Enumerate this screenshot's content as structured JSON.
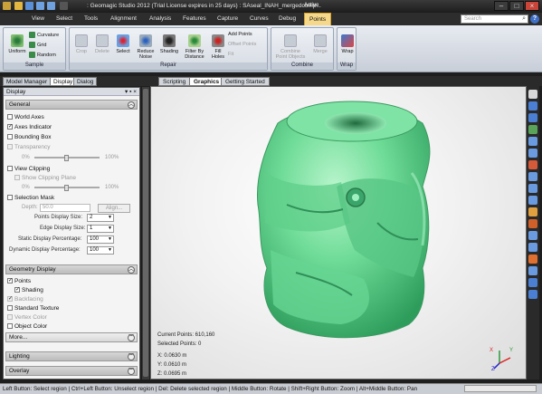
{
  "titlebar": {
    "title": ": Geomagic Studio 2012 (Trial License expires in 25 days)  : SAseal_INAH_mergedcomp...",
    "context_tab": "Active"
  },
  "menu": {
    "tabs": [
      "View",
      "Select",
      "Tools",
      "Alignment",
      "Analysis",
      "Features",
      "Capture",
      "Curves",
      "Debug",
      "Points"
    ],
    "active": "Points"
  },
  "search": {
    "placeholder": "Search"
  },
  "ribbon": {
    "sample": {
      "label": "Sample",
      "uniform": "Uniform",
      "curvature": "Curvature",
      "grid": "Grid",
      "random": "Random"
    },
    "repair": {
      "label": "Repair",
      "crop": "Crop",
      "delete": "Delete",
      "select": "Select",
      "reduce_noise": "Reduce Noise",
      "shading": "Shading",
      "filter_by_distance": "Filter By Distance",
      "fill_holes": "Fill Holes",
      "add_points": "Add Points",
      "offset_points": "Offset Points",
      "fit": "Fit"
    },
    "combine": {
      "label": "Combine",
      "combine_point_objects": "Combine Point Objects",
      "merge": "Merge"
    },
    "wrap": {
      "label": "Wrap",
      "wrap": "Wrap"
    }
  },
  "panel_tabs": [
    "Model Manager",
    "Display",
    "Dialog"
  ],
  "view_tabs": [
    "Scripting",
    "Graphics",
    "Getting Started"
  ],
  "display_panel": {
    "title": "Display",
    "general": {
      "label": "General",
      "world_axes": "World Axes",
      "axes_indicator": "Axes Indicator",
      "bounding_box": "Bounding Box",
      "transparency": "Transparency",
      "pct_min": "0%",
      "pct_max": "100%",
      "view_clipping": "View Clipping",
      "show_clipping_plane": "Show Clipping Plane",
      "selection_mask": "Selection Mask",
      "depth_label": "Depth:",
      "depth_value": "50.0",
      "align_btn": "Align...",
      "points_display_size_label": "Points Display Size:",
      "points_display_size": "2",
      "edge_display_size_label": "Edge Display Size:",
      "edge_display_size": "1",
      "static_display_pct_label": "Static Display Percentage:",
      "static_display_pct": "100",
      "dynamic_display_pct_label": "Dynamic Display Percentage:",
      "dynamic_display_pct": "100"
    },
    "geometry": {
      "label": "Geometry Display",
      "points": "Points",
      "shading": "Shading",
      "backfacing": "Backfacing",
      "standard_texture": "Standard Texture",
      "vertex_color": "Vertex Color",
      "object_color": "Object Color",
      "more": "More..."
    },
    "lighting": {
      "label": "Lighting"
    },
    "overlay": {
      "label": "Overlay"
    }
  },
  "viewport": {
    "current_points": "Current Points: 610,160",
    "selected_points": "Selected Points: 0",
    "x": "X:   0.0630 m",
    "y": "Y:   0.0610 m",
    "z": "Z:   0.0695 m",
    "axis_x": "X",
    "axis_y": "Y",
    "axis_z": "Z"
  },
  "status": {
    "text": "Left Button: Select region | Ctrl+Left Button: Unselect region | Del: Delete selected region | Middle Button: Rotate | Shift+Right Button: Zoom | Alt+Middle Button: Pan"
  },
  "colors": {
    "accent": "#f6d88a",
    "model": "#6fdc98"
  }
}
